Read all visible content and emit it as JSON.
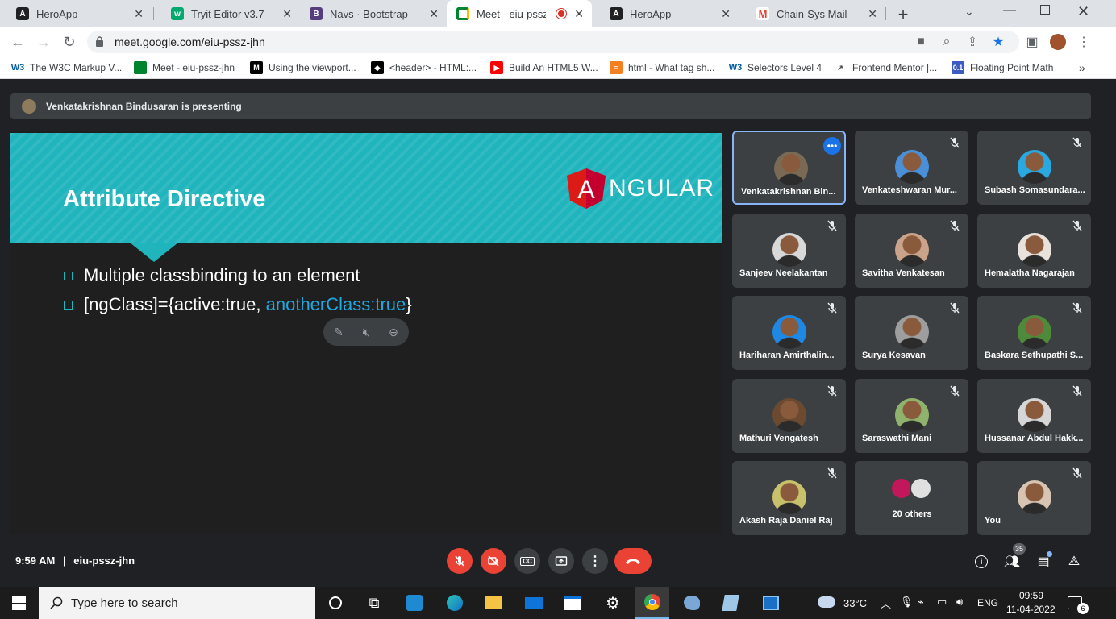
{
  "tabs": [
    {
      "title": "HeroApp",
      "icon": "angular-icon"
    },
    {
      "title": "Tryit Editor v3.7",
      "icon": "w3schools-icon"
    },
    {
      "title": "Navs · Bootstrap",
      "icon": "bootstrap-icon"
    },
    {
      "title": "Meet - eiu-pssz-jh",
      "icon": "meet-icon",
      "active": true
    },
    {
      "title": "HeroApp",
      "icon": "angular-icon"
    },
    {
      "title": "Chain-Sys Mail",
      "icon": "gmail-icon"
    }
  ],
  "address": {
    "url": "meet.google.com/eiu-pssz-jhn"
  },
  "bookmarks": [
    "The W3C Markup V...",
    "Meet - eiu-pssz-jhn",
    "Using the viewport...",
    "<header> - HTML:...",
    "Build An HTML5 W...",
    "html - What tag sh...",
    "Selectors Level 4",
    "Frontend Mentor |...",
    "Floating Point Math"
  ],
  "bookmarks_more": "»",
  "presenting": {
    "text": "Venkatakrishnan Bindusaran is presenting"
  },
  "slide": {
    "title": "Attribute Directive",
    "logo_letter": "A",
    "logo_text": "NGULAR",
    "bullets": [
      {
        "text": "Multiple classbinding to an element",
        "highlight": ""
      },
      {
        "text": "[ngClass]={active:true, ",
        "highlight": "anotherClass:true",
        "tail": "}"
      }
    ]
  },
  "participants": [
    {
      "name": "Venkatakrishnan Bin...",
      "selected": true,
      "more": "•••",
      "color": "#7a6a55"
    },
    {
      "name": "Venkateshwaran Mur...",
      "color": "#4a90d9"
    },
    {
      "name": "Subash Somasundara...",
      "color": "#29a9e0"
    },
    {
      "name": "Sanjeev Neelakantan",
      "color": "#d8d8d8"
    },
    {
      "name": "Savitha Venkatesan",
      "color": "#c9a38a"
    },
    {
      "name": "Hemalatha Nagarajan",
      "color": "#e9e2dc"
    },
    {
      "name": "Hariharan Amirthalin...",
      "color": "#1e88e5"
    },
    {
      "name": "Surya Kesavan",
      "color": "#9e9e9e"
    },
    {
      "name": "Baskara Sethupathi S...",
      "color": "#4f8a3b"
    },
    {
      "name": "Mathuri Vengatesh",
      "color": "#6b4a2f"
    },
    {
      "name": "Saraswathi Mani",
      "color": "#8fb36c"
    },
    {
      "name": "Hussanar Abdul Hakk...",
      "color": "#d6d6d6"
    },
    {
      "name": "Akash Raja Daniel Raj",
      "color": "#c6c16a"
    },
    {
      "name": "20 others",
      "group": true,
      "color": "#c2185b"
    },
    {
      "name": "You",
      "color": "#d7c4b2"
    }
  ],
  "bottom": {
    "time": "9:59 AM",
    "separator": "|",
    "code": "eiu-pssz-jhn",
    "people_count": "35"
  },
  "taskbar": {
    "search_placeholder": "Type here to search",
    "weather": "33°C",
    "lang": "ENG",
    "time": "09:59",
    "date": "11-04-2022",
    "notif": "6"
  },
  "colors": {
    "accent": "#20b4bd",
    "end_call": "#ea4335",
    "meet_bg": "#202124",
    "tile_bg": "#3c4043",
    "link_blue": "#20a8e0"
  }
}
